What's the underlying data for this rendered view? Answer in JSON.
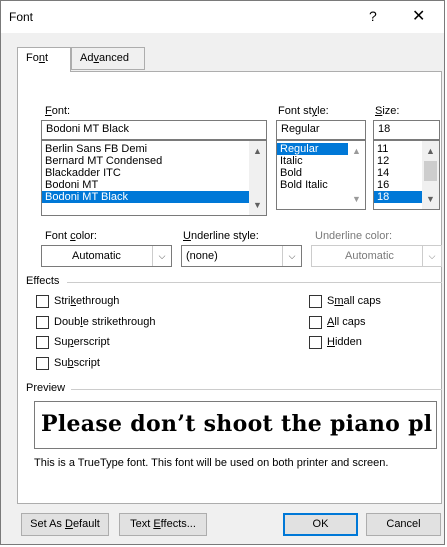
{
  "dialog": {
    "title": "Font",
    "help": "?",
    "close": "✕"
  },
  "tabs": [
    {
      "label_pre": "Fo",
      "label_u": "n",
      "label_post": "t"
    },
    {
      "label_pre": "Ad",
      "label_u": "v",
      "label_post": "anced"
    }
  ],
  "font": {
    "label_u": "F",
    "label_post": "ont:",
    "value": "Bodoni MT Black",
    "items": [
      "Berlin Sans FB Demi",
      "Bernard MT Condensed",
      "Blackadder ITC",
      "Bodoni MT",
      "Bodoni MT Black"
    ]
  },
  "style": {
    "label_pre": "Font st",
    "label_u": "y",
    "label_post": "le:",
    "value": "Regular",
    "items": [
      "Regular",
      "Italic",
      "Bold",
      "Bold Italic"
    ]
  },
  "size": {
    "label_u": "S",
    "label_post": "ize:",
    "value": "18",
    "items": [
      "11",
      "12",
      "14",
      "16",
      "18"
    ]
  },
  "font_color": {
    "label_pre": "Font ",
    "label_u": "c",
    "label_post": "olor:",
    "value": "Automatic"
  },
  "underline_style": {
    "label_u": "U",
    "label_post": "nderline style:",
    "value": "(none)"
  },
  "underline_color": {
    "label": "Underline color:",
    "value": "Automatic"
  },
  "effects": {
    "heading": "Effects",
    "left": [
      {
        "pre": "Stri",
        "u": "k",
        "post": "ethrough"
      },
      {
        "pre": "Doub",
        "u": "l",
        "post": "e strikethrough"
      },
      {
        "pre": "Su",
        "u": "p",
        "post": "erscript"
      },
      {
        "pre": "Su",
        "u": "b",
        "post": "script"
      }
    ],
    "right": [
      {
        "pre": "S",
        "u": "m",
        "post": "all caps"
      },
      {
        "pre": "",
        "u": "A",
        "post": "ll caps"
      },
      {
        "pre": "",
        "u": "H",
        "post": "idden"
      }
    ]
  },
  "preview": {
    "heading": "Preview",
    "sample": "Please don’t shoot the piano pl",
    "note": "This is a TrueType font. This font will be used on both printer and screen."
  },
  "buttons": {
    "default": {
      "pre": "Set As ",
      "u": "D",
      "post": "efault"
    },
    "effects": {
      "pre": "Text ",
      "u": "E",
      "post": "ffects..."
    },
    "ok": "OK",
    "cancel": "Cancel"
  },
  "colors": {
    "selection": "#0078d7",
    "focus_border": "#0078d7"
  }
}
